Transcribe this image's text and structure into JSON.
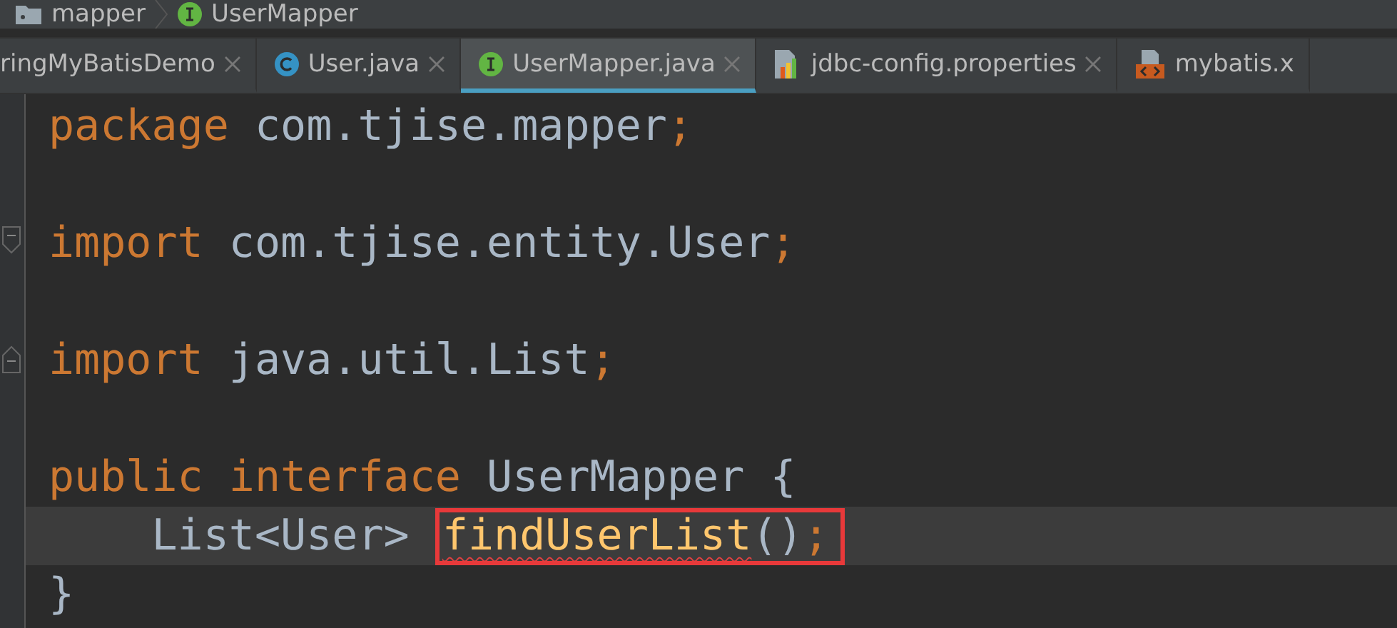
{
  "breadcrumb": [
    {
      "kind": "folder",
      "label": "mapper"
    },
    {
      "kind": "interface",
      "label": "UserMapper"
    }
  ],
  "tabs": [
    {
      "kind": "none",
      "label": "ringMyBatisDemo",
      "selected": false,
      "closable": true
    },
    {
      "kind": "class",
      "label": "User.java",
      "selected": false,
      "closable": true
    },
    {
      "kind": "interface",
      "label": "UserMapper.java",
      "selected": true,
      "closable": true
    },
    {
      "kind": "properties",
      "label": "jdbc-config.properties",
      "selected": false,
      "closable": true
    },
    {
      "kind": "xml",
      "label": "mybatis.x",
      "selected": false,
      "closable": false
    }
  ],
  "code_lines": [
    {
      "kind": "code",
      "current": false,
      "tokens": [
        {
          "kind": "keyword",
          "text": "package"
        },
        {
          "kind": "plain",
          "text": " com.tjise.mapper"
        },
        {
          "kind": "punct",
          "text": ";"
        }
      ]
    },
    {
      "kind": "blank",
      "current": false
    },
    {
      "kind": "fold_start",
      "current": false,
      "tokens": [
        {
          "kind": "keyword",
          "text": "import"
        },
        {
          "kind": "plain",
          "text": " com.tjise.entity.User"
        },
        {
          "kind": "punct",
          "text": ";"
        }
      ]
    },
    {
      "kind": "blank",
      "current": false
    },
    {
      "kind": "fold_end",
      "current": false,
      "tokens": [
        {
          "kind": "keyword",
          "text": "import"
        },
        {
          "kind": "plain",
          "text": " java.util.List"
        },
        {
          "kind": "punct",
          "text": ";"
        }
      ]
    },
    {
      "kind": "blank",
      "current": false
    },
    {
      "kind": "code",
      "current": false,
      "tokens": [
        {
          "kind": "keyword",
          "text": "public interface"
        },
        {
          "kind": "plain",
          "text": " UserMapper {"
        }
      ]
    },
    {
      "kind": "code",
      "current": true,
      "tokens": [
        {
          "kind": "plain",
          "text": "    List<User> "
        },
        {
          "kind": "method",
          "text": "findUserList",
          "boxed": true,
          "error": true
        },
        {
          "kind": "plain",
          "text": "()",
          "boxed": true
        },
        {
          "kind": "punct",
          "text": ";",
          "boxed": true
        }
      ]
    },
    {
      "kind": "code",
      "current": false,
      "tokens": [
        {
          "kind": "plain",
          "text": "}"
        }
      ]
    }
  ]
}
